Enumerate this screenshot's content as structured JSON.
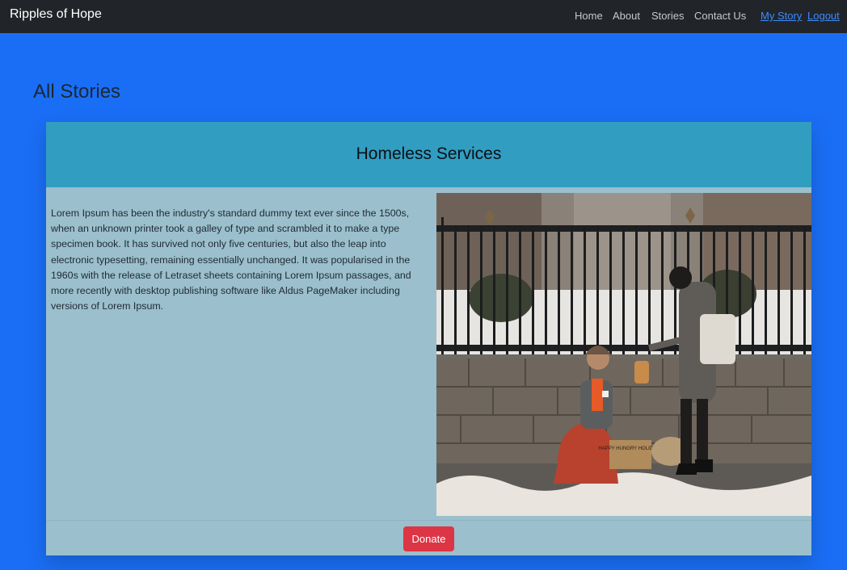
{
  "navbar": {
    "brand": "Ripples of Hope",
    "links": [
      {
        "label": "Home"
      },
      {
        "label": "About"
      },
      {
        "label": "Stories"
      },
      {
        "label": "Contact Us"
      }
    ],
    "user_links": [
      {
        "label": "My Story"
      },
      {
        "label": "Logout"
      }
    ]
  },
  "page": {
    "title": "All Stories"
  },
  "story": {
    "title": "Homeless Services",
    "body": "Lorem Ipsum has been the industry's standard dummy text ever since the 1500s, when an unknown printer took a galley of type and scrambled it to make a type specimen book. It has survived not only five centuries, but also the leap into electronic typesetting, remaining essentially unchanged. It was popularised in the 1960s with the release of Letraset sheets containing Lorem Ipsum passages, and more recently with desktop publishing software like Aldus PageMaker including versions of Lorem Ipsum.",
    "image_sign_text": "HAPPY HUNGRY HOLIDAYS",
    "donate_label": "Donate"
  },
  "colors": {
    "page_background": "#1a6ef5",
    "navbar": "#212529",
    "card_header": "#319dc1",
    "card_body": "#9bbfcc",
    "donate": "#dc3545",
    "user_link": "#3d8bfd"
  }
}
